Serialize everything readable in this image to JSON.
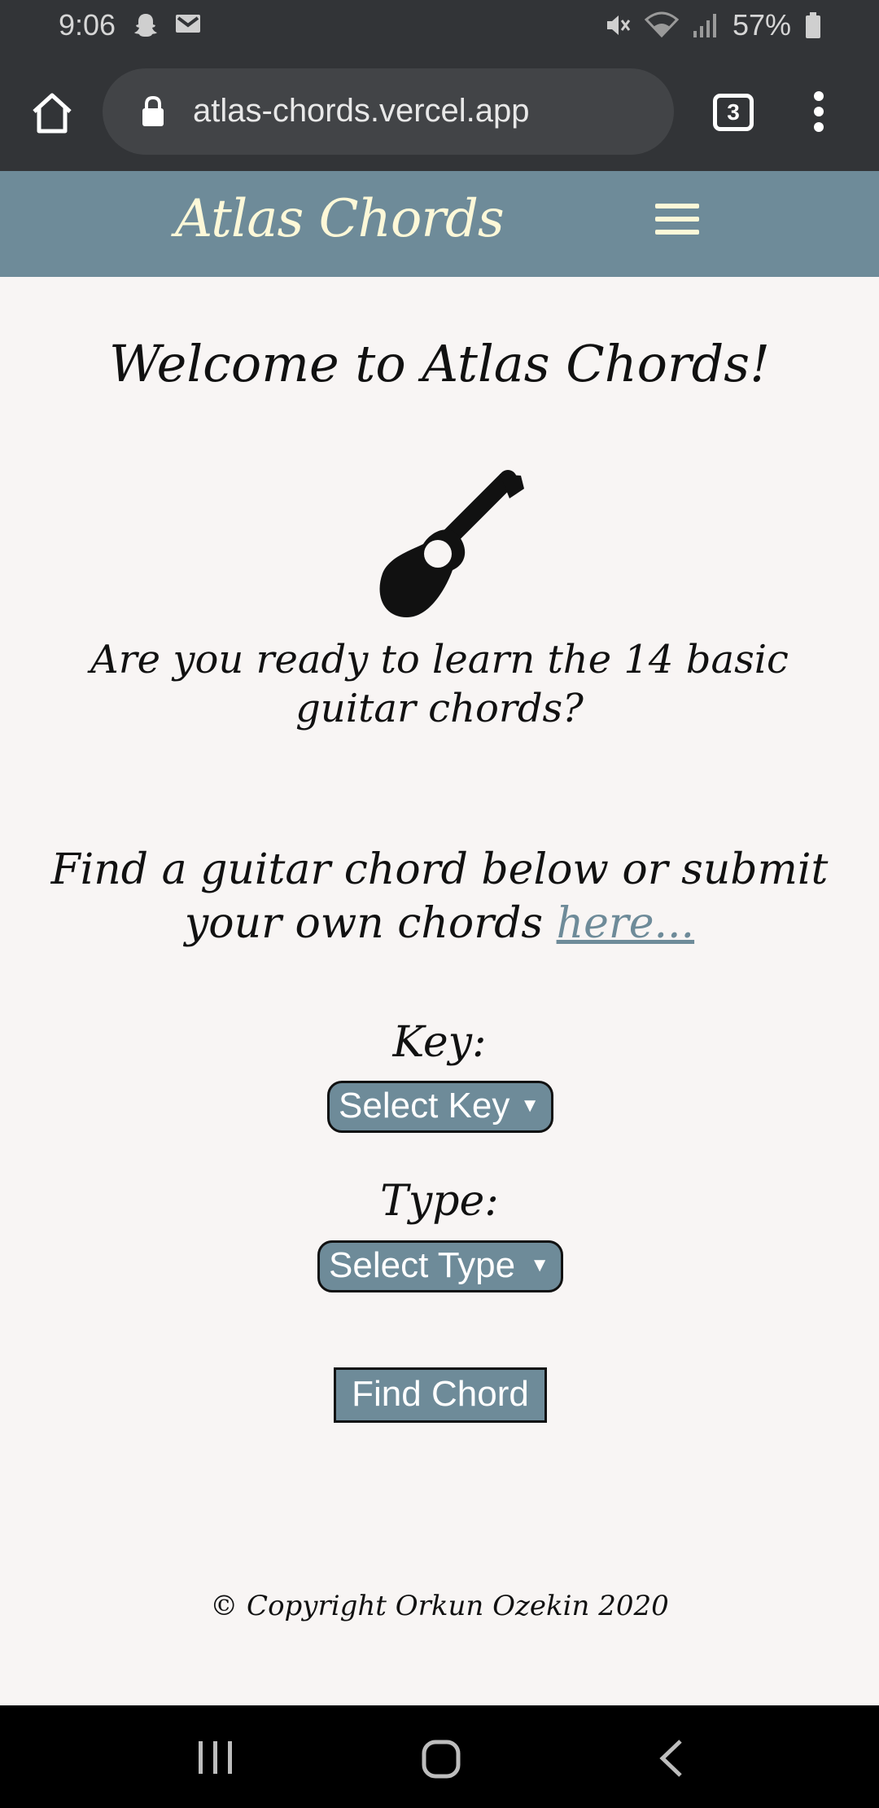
{
  "status_bar": {
    "time": "9:06",
    "battery": "57%"
  },
  "browser": {
    "url": "atlas-chords.vercel.app",
    "tab_count": "3"
  },
  "site_nav": {
    "brand": "Atlas Chords"
  },
  "main": {
    "welcome": "Welcome to Atlas Chords!",
    "ready_question": "Are you ready to learn the 14 basic guitar chords?",
    "find_prefix": "Find a guitar chord below or submit your own chords ",
    "find_link": "here...",
    "key_label": "Key:",
    "key_select": "Select Key",
    "type_label": "Type:",
    "type_select": "Select Type",
    "find_button": "Find Chord"
  },
  "footer": {
    "copyright": "© Copyright Orkun Ozekin 2020"
  },
  "colors": {
    "accent": "#6e8b99",
    "brand_text": "#fdf8d8",
    "page_bg": "#f8f5f4",
    "chrome_bar": "#323437"
  }
}
